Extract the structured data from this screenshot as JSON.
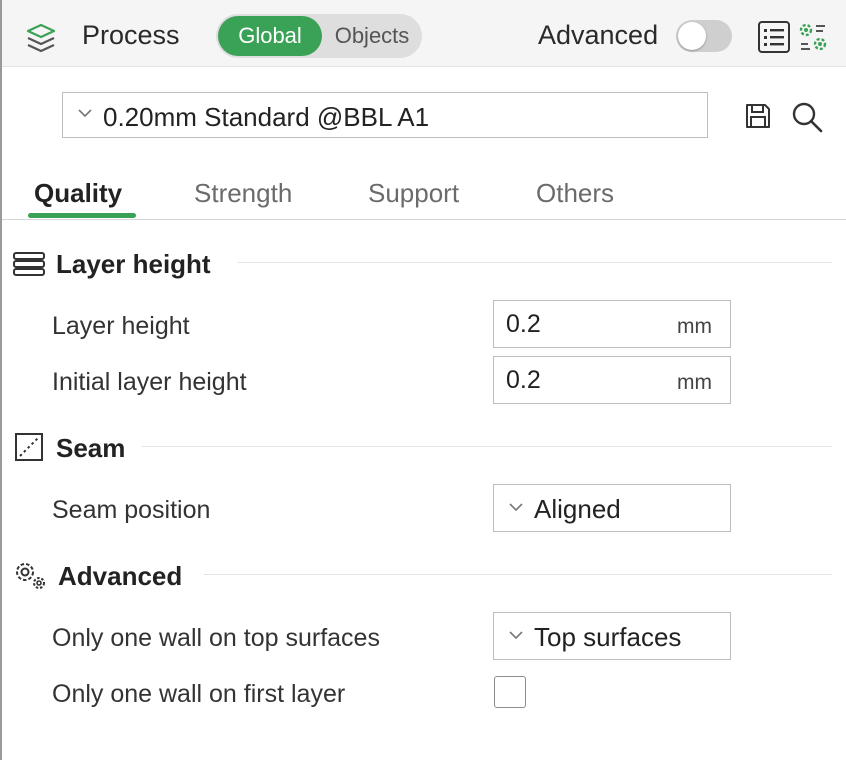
{
  "header": {
    "title": "Process",
    "mode_toggle": {
      "options": [
        "Global",
        "Objects"
      ],
      "selected": "Global"
    },
    "advanced_label": "Advanced",
    "advanced_on": false
  },
  "preset": {
    "value": "0.20mm Standard @BBL A1"
  },
  "tabs": [
    {
      "label": "Quality",
      "active": true
    },
    {
      "label": "Strength",
      "active": false
    },
    {
      "label": "Support",
      "active": false
    },
    {
      "label": "Others",
      "active": false
    }
  ],
  "sections": {
    "layer_height": {
      "title": "Layer height",
      "layer_height": {
        "label": "Layer height",
        "value": "0.2",
        "unit": "mm"
      },
      "initial_layer_height": {
        "label": "Initial layer height",
        "value": "0.2",
        "unit": "mm"
      }
    },
    "seam": {
      "title": "Seam",
      "seam_position": {
        "label": "Seam position",
        "value": "Aligned"
      }
    },
    "advanced": {
      "title": "Advanced",
      "only_one_wall_top": {
        "label": "Only one wall on top surfaces",
        "value": "Top surfaces"
      },
      "only_one_wall_first_layer": {
        "label": "Only one wall on first layer",
        "checked": false
      }
    }
  },
  "colors": {
    "accent": "#3aa256",
    "header_bg": "#f5f5f5",
    "border": "#bdbdbd"
  }
}
